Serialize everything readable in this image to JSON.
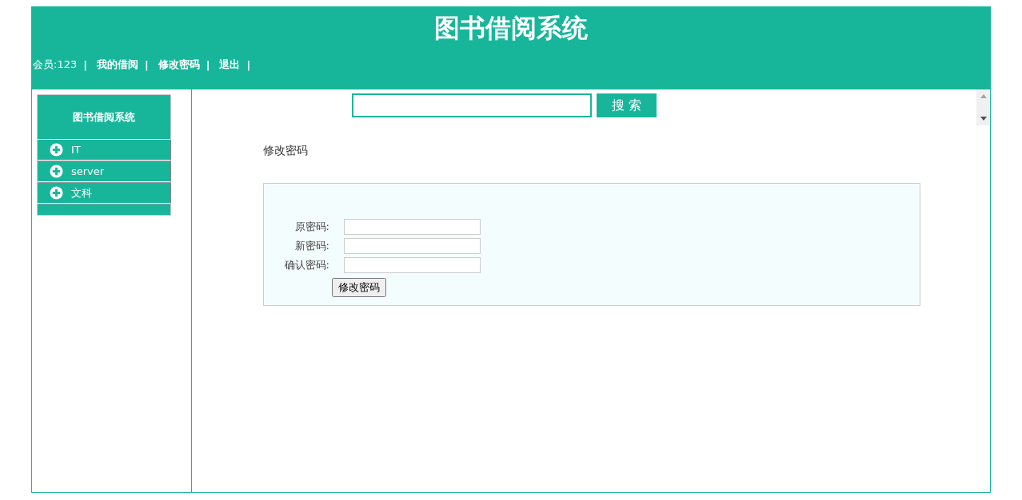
{
  "header": {
    "title": "图书借阅系统",
    "nav": [
      {
        "label": "会员:123",
        "kind": "text",
        "separator": "|"
      },
      {
        "label": "我的借阅",
        "kind": "link",
        "separator": "|"
      },
      {
        "label": "修改密码",
        "kind": "link",
        "separator": "|"
      },
      {
        "label": "退出",
        "kind": "link",
        "separator": "|"
      }
    ]
  },
  "sidebar": {
    "title": "图书借阅系统",
    "items": [
      {
        "label": "IT",
        "expanded": false
      },
      {
        "label": "server",
        "expanded": false
      },
      {
        "label": "文科",
        "expanded": false
      }
    ]
  },
  "search": {
    "button": "搜 索"
  },
  "page_title": "修改密码",
  "form": {
    "fields": [
      {
        "label": "原密码:"
      },
      {
        "label": "新密码:"
      },
      {
        "label": "确认密码:"
      }
    ],
    "submit": "修改密码"
  }
}
